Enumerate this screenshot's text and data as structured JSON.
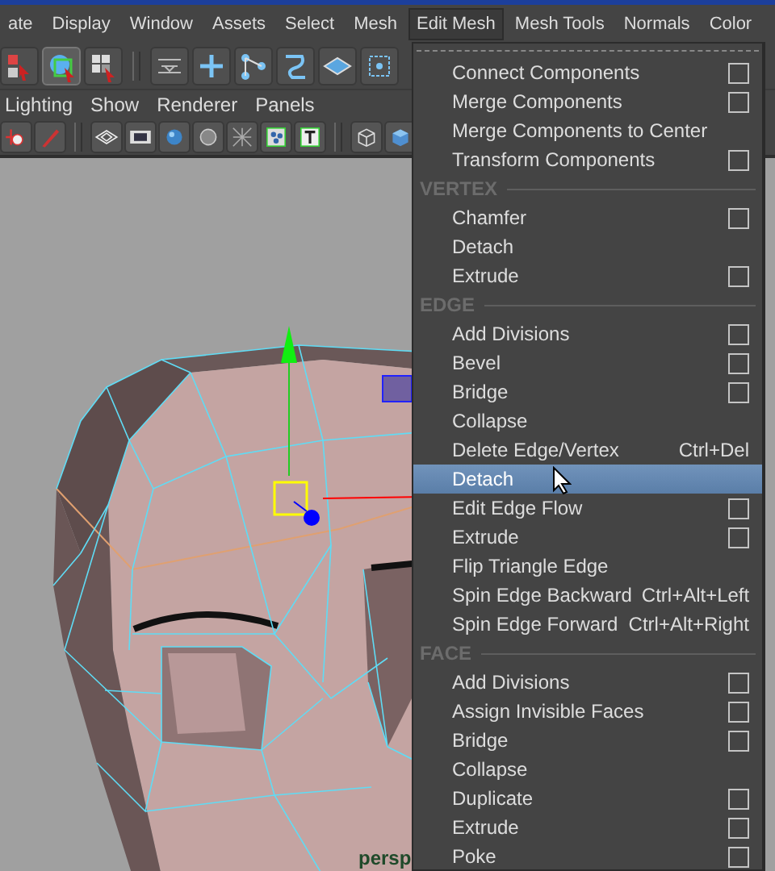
{
  "menu_bar": [
    {
      "label": "ate",
      "selected": false
    },
    {
      "label": "Display",
      "selected": false
    },
    {
      "label": "Window",
      "selected": false
    },
    {
      "label": "Assets",
      "selected": false
    },
    {
      "label": "Select",
      "selected": false
    },
    {
      "label": "Mesh",
      "selected": false
    },
    {
      "label": "Edit Mesh",
      "selected": true
    },
    {
      "label": "Mesh Tools",
      "selected": false
    },
    {
      "label": "Normals",
      "selected": false
    },
    {
      "label": "Color",
      "selected": false
    }
  ],
  "panel_menu": [
    "Lighting",
    "Show",
    "Renderer",
    "Panels"
  ],
  "viewport": {
    "camera": "persp"
  },
  "edit_mesh_menu": {
    "items": [
      {
        "kind": "item",
        "label": "Connect Components",
        "option_box": true,
        "selected": false
      },
      {
        "kind": "item",
        "label": "Merge Components",
        "option_box": true,
        "selected": false
      },
      {
        "kind": "item",
        "label": "Merge Components to Center",
        "option_box": false,
        "selected": false
      },
      {
        "kind": "item",
        "label": "Transform Components",
        "option_box": true,
        "selected": false
      },
      {
        "kind": "section",
        "label": "VERTEX"
      },
      {
        "kind": "item",
        "label": "Chamfer",
        "option_box": true,
        "selected": false
      },
      {
        "kind": "item",
        "label": "Detach",
        "option_box": false,
        "selected": false
      },
      {
        "kind": "item",
        "label": "Extrude",
        "option_box": true,
        "selected": false
      },
      {
        "kind": "section",
        "label": "EDGE"
      },
      {
        "kind": "item",
        "label": "Add Divisions",
        "option_box": true,
        "selected": false
      },
      {
        "kind": "item",
        "label": "Bevel",
        "option_box": true,
        "selected": false
      },
      {
        "kind": "item",
        "label": "Bridge",
        "option_box": true,
        "selected": false
      },
      {
        "kind": "item",
        "label": "Collapse",
        "option_box": false,
        "selected": false
      },
      {
        "kind": "item",
        "label": "Delete Edge/Vertex",
        "shortcut": "Ctrl+Del",
        "option_box": false,
        "selected": false
      },
      {
        "kind": "item",
        "label": "Detach",
        "option_box": false,
        "selected": true
      },
      {
        "kind": "item",
        "label": "Edit Edge Flow",
        "option_box": true,
        "selected": false
      },
      {
        "kind": "item",
        "label": "Extrude",
        "option_box": true,
        "selected": false
      },
      {
        "kind": "item",
        "label": "Flip Triangle Edge",
        "option_box": false,
        "selected": false
      },
      {
        "kind": "item",
        "label": "Spin Edge Backward",
        "shortcut": "Ctrl+Alt+Left",
        "option_box": false,
        "selected": false
      },
      {
        "kind": "item",
        "label": "Spin Edge Forward",
        "shortcut": "Ctrl+Alt+Right",
        "option_box": false,
        "selected": false
      },
      {
        "kind": "section",
        "label": "FACE"
      },
      {
        "kind": "item",
        "label": "Add Divisions",
        "option_box": true,
        "selected": false
      },
      {
        "kind": "item",
        "label": "Assign Invisible Faces",
        "option_box": true,
        "selected": false
      },
      {
        "kind": "item",
        "label": "Bridge",
        "option_box": true,
        "selected": false
      },
      {
        "kind": "item",
        "label": "Collapse",
        "option_box": false,
        "selected": false
      },
      {
        "kind": "item",
        "label": "Duplicate",
        "option_box": true,
        "selected": false
      },
      {
        "kind": "item",
        "label": "Extrude",
        "option_box": true,
        "selected": false
      },
      {
        "kind": "item",
        "label": "Poke",
        "option_box": true,
        "selected": false
      }
    ]
  }
}
